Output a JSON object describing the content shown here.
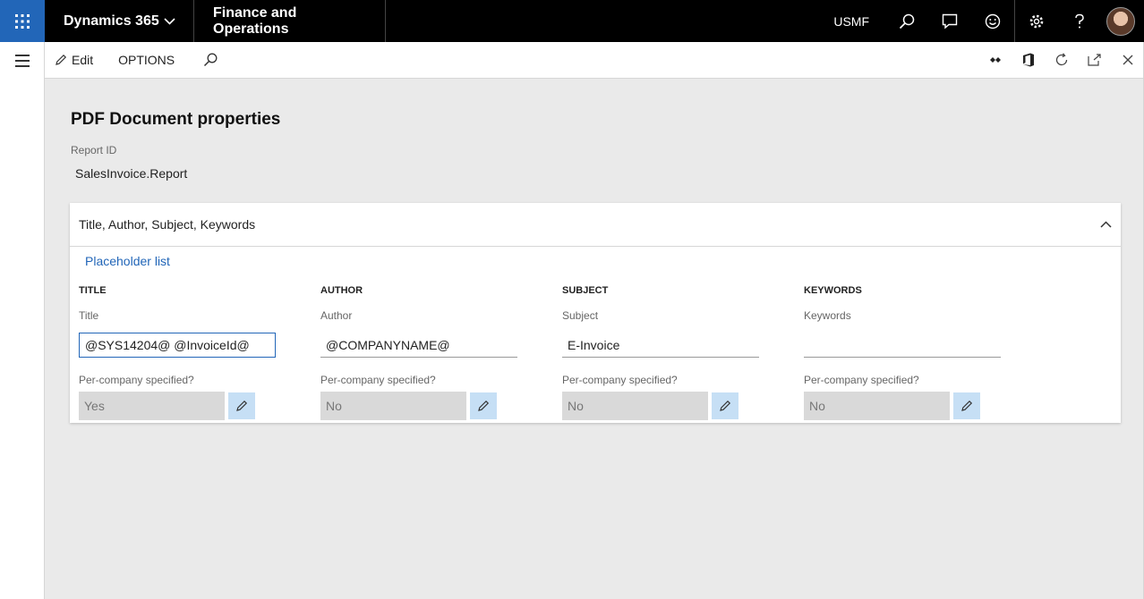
{
  "topbar": {
    "brand": "Dynamics 365",
    "app_name": "Finance and Operations",
    "company": "USMF"
  },
  "actionbar": {
    "edit_label": "Edit",
    "options_label": "OPTIONS"
  },
  "page": {
    "title": "PDF Document properties",
    "report_id_label": "Report ID",
    "report_id_value": "SalesInvoice.Report"
  },
  "panel": {
    "header": "Title, Author, Subject, Keywords",
    "placeholder_link": "Placeholder list",
    "per_company_label": "Per-company specified?",
    "columns": [
      {
        "heading": "TITLE",
        "label": "Title",
        "value": "@SYS14204@ @InvoiceId@",
        "per_company": "Yes"
      },
      {
        "heading": "AUTHOR",
        "label": "Author",
        "value": "@COMPANYNAME@",
        "per_company": "No"
      },
      {
        "heading": "SUBJECT",
        "label": "Subject",
        "value": "E-Invoice",
        "per_company": "No"
      },
      {
        "heading": "KEYWORDS",
        "label": "Keywords",
        "value": "",
        "per_company": "No"
      }
    ]
  },
  "colors": {
    "accent": "#2266b8",
    "topbar": "#000000",
    "edit_button_bg": "#c6dff5"
  }
}
